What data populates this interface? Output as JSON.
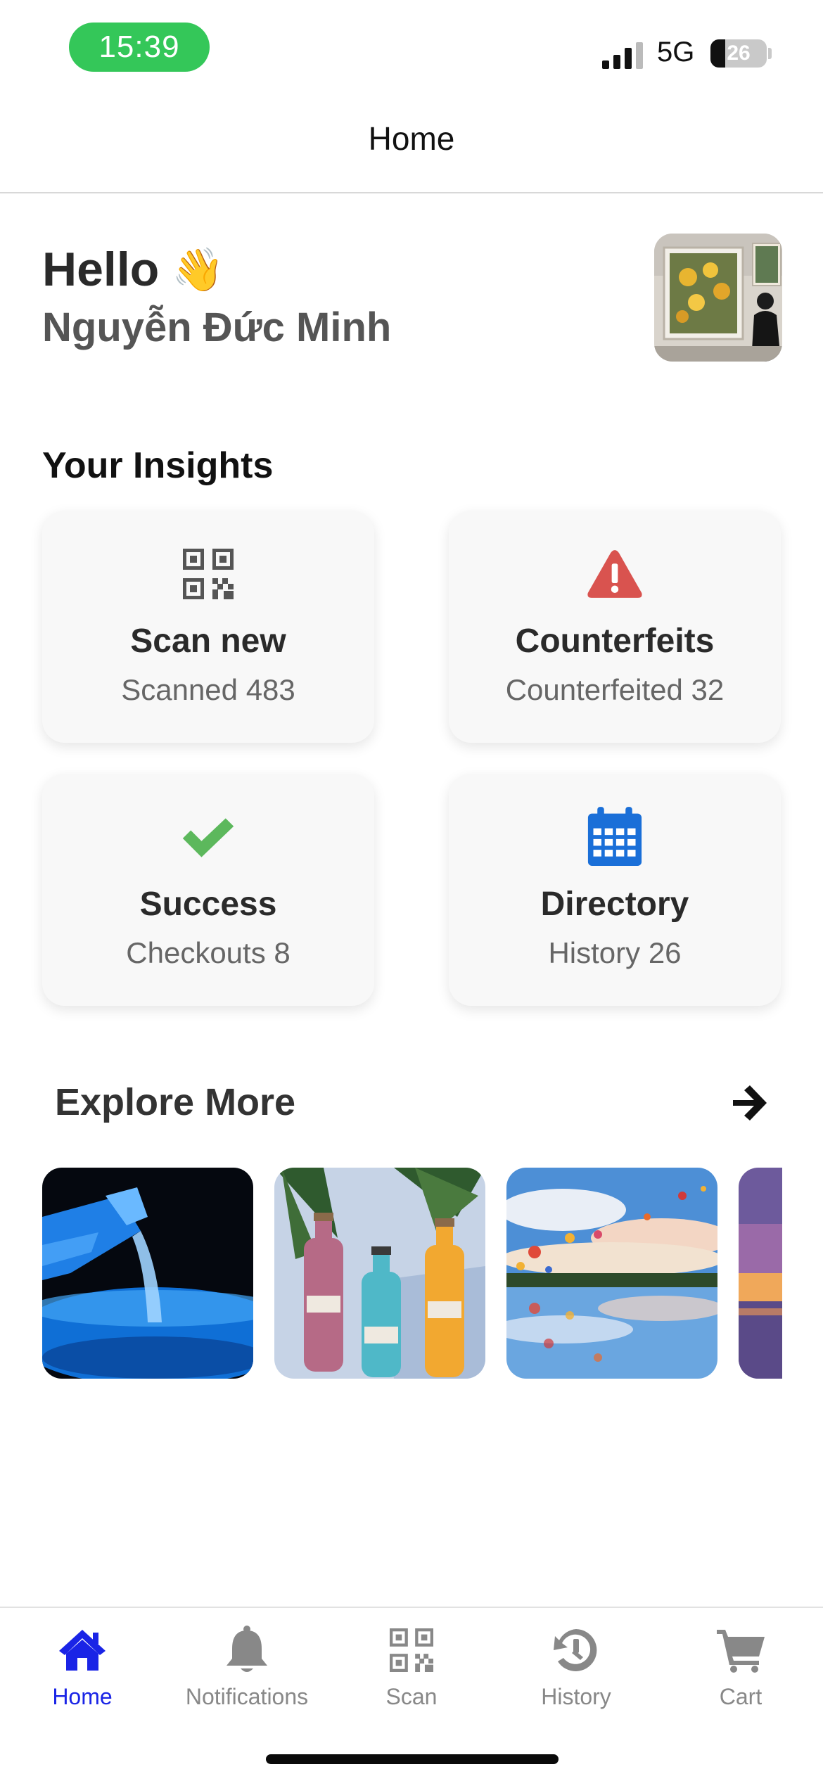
{
  "status_bar": {
    "time": "15:39",
    "network": "5G",
    "battery": "26",
    "battery_level": 0.26
  },
  "nav": {
    "title": "Home"
  },
  "greeting": {
    "hello": "Hello",
    "wave_icon": "👋",
    "name": "Nguyễn Đức Minh"
  },
  "insights": {
    "title": "Your Insights",
    "cards": [
      {
        "icon": "qr-code-icon",
        "title": "Scan new",
        "subtitle": "Scanned 483",
        "icon_color": "#555555"
      },
      {
        "icon": "warning-triangle-icon",
        "title": "Counterfeits",
        "subtitle": "Counterfeited 32",
        "icon_color": "#d9534f"
      },
      {
        "icon": "checkmark-icon",
        "title": "Success",
        "subtitle": "Checkouts 8",
        "icon_color": "#5cb85c"
      },
      {
        "icon": "calendar-icon",
        "title": "Directory",
        "subtitle": "History 26",
        "icon_color": "#1a6fd8"
      }
    ]
  },
  "explore": {
    "title": "Explore More",
    "arrow_icon": "arrow-right-icon",
    "thumbnails": [
      "water-pour-image",
      "rio-bottles-image",
      "hot-air-balloons-image",
      "sunset-image"
    ]
  },
  "tab_bar": {
    "active_color": "#1a24e6",
    "inactive_color": "#888888",
    "tabs": [
      {
        "label": "Home",
        "icon": "home-icon",
        "active": true
      },
      {
        "label": "Notifications",
        "icon": "bell-icon",
        "active": false
      },
      {
        "label": "Scan",
        "icon": "qr-code-icon",
        "active": false
      },
      {
        "label": "History",
        "icon": "history-icon",
        "active": false
      },
      {
        "label": "Cart",
        "icon": "cart-icon",
        "active": false
      }
    ]
  }
}
